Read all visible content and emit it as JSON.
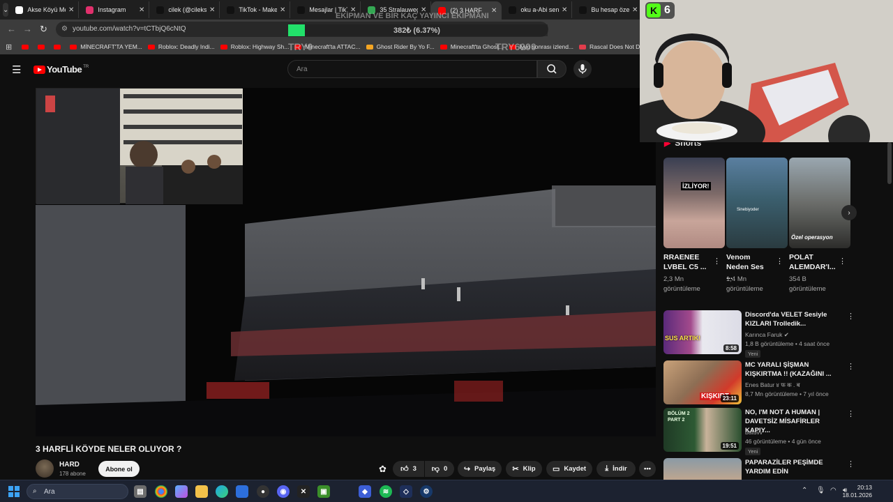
{
  "browser": {
    "tabs": [
      {
        "label": "Akse Köyü Me",
        "favicon": "google-icon",
        "color": "#ffffff"
      },
      {
        "label": "Instagram",
        "favicon": "instagram-icon",
        "color": "#e1306c"
      },
      {
        "label": "cilek (@cileksb",
        "favicon": "tiktok-icon",
        "color": "#111111"
      },
      {
        "label": "TikTok - Make",
        "favicon": "tiktok-icon",
        "color": "#111111"
      },
      {
        "label": "Mesajlar | TikTo",
        "favicon": "tiktok-icon",
        "color": "#111111"
      },
      {
        "label": "35 Stralauweg",
        "favicon": "maps-icon",
        "color": "#34a853"
      },
      {
        "label": "(2) 3 HARF",
        "favicon": "youtube-icon",
        "color": "#ff0000"
      },
      {
        "label": "oku a-Abi sen",
        "favicon": "tiktok-icon",
        "color": "#111111"
      },
      {
        "label": "Bu hesap özel",
        "favicon": "tiktok-icon",
        "color": "#111111"
      }
    ],
    "url": "youtube.com/watch?v=tCTbjQ6cNtQ",
    "bookmarks": [
      {
        "label": "",
        "icon": "youtube-icon"
      },
      {
        "label": "",
        "icon": "youtube-icon"
      },
      {
        "label": "",
        "icon": "youtube-icon"
      },
      {
        "label": "MİNECRAFT'TA YEM...",
        "icon": "youtube-icon"
      },
      {
        "label": "Roblox: Deadly Indi...",
        "icon": "youtube-icon"
      },
      {
        "label": "Roblox: Highway Sh...",
        "icon": "youtube-icon"
      },
      {
        "label": "Minecraft'ta ATTAC...",
        "icon": "youtube-icon"
      },
      {
        "label": "Ghost Rider By Yo F...",
        "icon": "scratch-icon"
      },
      {
        "label": "Minecraft'ta Ghost...",
        "icon": "youtube-icon"
      },
      {
        "label": "İyyo sonrası izlend...",
        "icon": "youtube-icon"
      },
      {
        "label": "Rascal Does Not Dr...",
        "icon": "bookmark-icon"
      }
    ]
  },
  "overlay": {
    "goal_title": "EKİPMAN VE BİR KAÇ YAYINCI EKİPMANI",
    "goal_progress": "382₺ (6.37%)",
    "goal_start": "TRY0",
    "goal_end": "TRY6000",
    "goal_fraction": 0.0637,
    "kick_count": "6"
  },
  "youtube": {
    "logo": "YouTube",
    "country": "TR",
    "search_placeholder": "Ara",
    "video_title": "3 HARFLİ KÖYDE NELER OLUYOR ?",
    "channel_name": "HARD",
    "subscribers": "178 abone",
    "subscribe_label": "Abone ol",
    "likes": "3",
    "dislikes": "0",
    "share_label": "Paylaş",
    "clip_label": "Klip",
    "save_label": "Kaydet",
    "download_label": "İndir",
    "shorts_header": "Shorts",
    "shorts": [
      {
        "title": "RRAENEE LVBEL C5 ...",
        "views": "2,3 Mn",
        "views_unit": "görüntüleme",
        "overlay": "İZLİYOR!"
      },
      {
        "title": "Venom Neden Ses ...",
        "views": "1,4 Mn",
        "views_unit": "görüntüleme",
        "overlay": "Sinebiyoder"
      },
      {
        "title": "POLAT ALEMDAR'I...",
        "views": "354 B",
        "views_unit": "görüntüleme",
        "overlay": "Özel operasyon"
      }
    ],
    "recommendations": [
      {
        "title": "Discord'da VELET Sesiyle KIZLARI Trolledik...",
        "channel": "Karınca Faruk",
        "meta": "1,8 B görüntüleme • 4 saat önce",
        "badge": "Yeni",
        "duration": "8:58",
        "thumb_text": "SUS ARTIK!"
      },
      {
        "title": "MC YARALI ŞİŞMAN KIŞKIRTMA !! (KAZAĞINI ...",
        "channel": "Enes Batur ४ फ क . ब",
        "meta": "8,7 Mn görüntüleme • 7 yıl önce",
        "badge": "",
        "duration": "23:11",
        "thumb_text": "KIŞKIRT"
      },
      {
        "title": "NO, I'M NOT A HUMAN | DAVETSİZ MİSAFİRLER KAPIY...",
        "channel": "batuvv",
        "meta": "46 görüntüleme • 4 gün önce",
        "badge": "Yeni",
        "duration": "19:51",
        "thumb_text": "BÖLÜM 2 PART 2"
      },
      {
        "title": "PAPARAZİLER PEŞİMDE YARDIM EDİN",
        "channel": "",
        "meta": "",
        "badge": "",
        "duration": "",
        "thumb_text": ""
      }
    ]
  },
  "taskbar": {
    "search_placeholder": "Ara",
    "time": "20:13",
    "date": "18.01.2026"
  }
}
